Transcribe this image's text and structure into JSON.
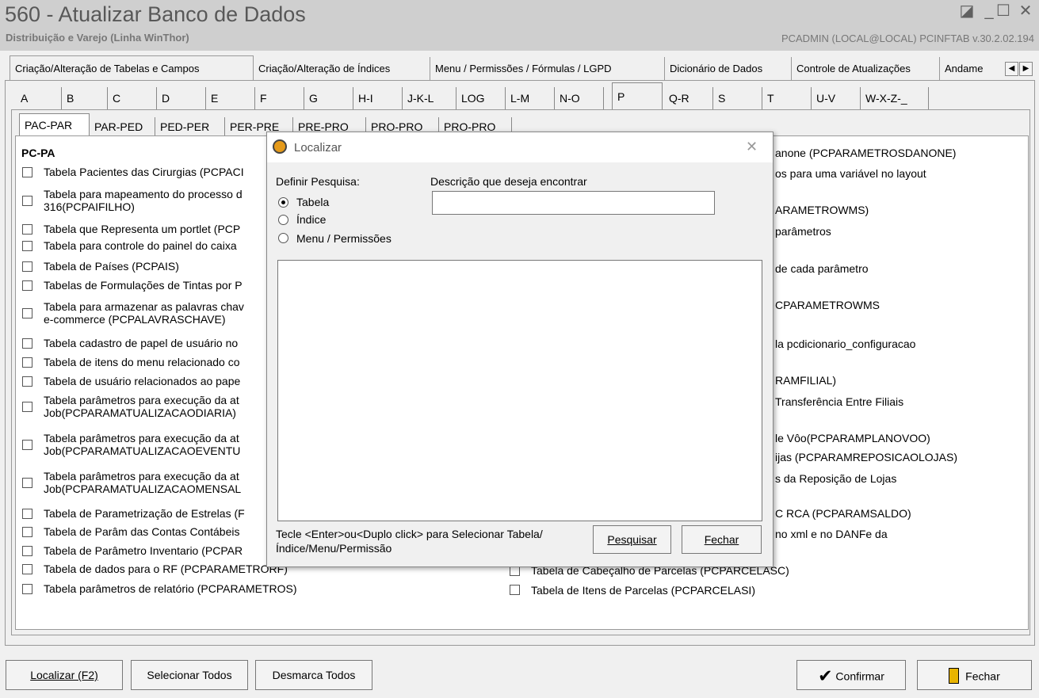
{
  "window": {
    "title": "560 - Atualizar Banco de Dados",
    "subtitle": "Distribuição e Varejo (Linha WinThor)",
    "user_info": "PCADMIN (LOCAL@LOCAL)  PCINFTAB  v.30.2.02.194",
    "controls": [
      "◪",
      "_",
      "☐",
      "✕"
    ]
  },
  "main_tabs": [
    "Criação/Alteração de Tabelas e Campos",
    "Criação/Alteração de Índices",
    "Menu / Permissões / Fórmulas / LGPD",
    "Dicionário de Dados",
    "Controle de Atualizações",
    "Andame"
  ],
  "tab_scroll": [
    "◀",
    "▶"
  ],
  "letter_tabs": [
    "A",
    "B",
    "C",
    "D",
    "E",
    "F",
    "G",
    "H-I",
    "J-K-L",
    "LOG",
    "L-M",
    "N-O",
    "P",
    "Q-R",
    "S",
    "T",
    "U-V",
    "W-X-Z-_"
  ],
  "sub_tabs": [
    "PAC-PAR",
    "PAR-PED",
    "PED-PER",
    "PER-PRE",
    "PRE-PRO",
    "PRO-PRO",
    "PRO-PRO"
  ],
  "section_title": "PC-PA",
  "left_items": [
    [
      "Tabela Pacientes das Cirurgias (PCPACI"
    ],
    [
      "Tabela para mapeamento do processo d",
      "316(PCPAIFILHO)"
    ],
    [
      "Tabela que Representa um portlet (PCP"
    ],
    [
      "Tabela para controle do painel do caixa"
    ],
    [
      "Tabela de Países (PCPAIS)"
    ],
    [
      "Tabelas de Formulações de Tintas por P"
    ],
    [
      "Tabela para armazenar as palavras chav",
      "e-commerce (PCPALAVRASCHAVE)"
    ],
    [
      "Tabela cadastro de papel de usuário no"
    ],
    [
      "Tabela de itens do menu relacionado co"
    ],
    [
      "Tabela de usuário relacionados ao pape"
    ],
    [
      "Tabela parâmetros para execução da at",
      "Job(PCPARAMATUALIZACAODIARIA)"
    ],
    [
      "Tabela parâmetros para execução da at",
      "Job(PCPARAMATUALIZACAOEVENTU"
    ],
    [
      "Tabela parâmetros para execução da at",
      "Job(PCPARAMATUALIZACAOMENSAL"
    ],
    [
      "Tabela de Parametrização de Estrelas (F"
    ],
    [
      "Tabela de Parâm das Contas Contábeis"
    ],
    [
      "Tabela de Parâmetro Inventario (PCPAR"
    ],
    [
      "Tabela de dados para o RF (PCPARAMETRORF)"
    ],
    [
      "Tabela parâmetros de relatório (PCPARAMETROS)"
    ]
  ],
  "right_fragments": [
    "anone (PCPARAMETROSDANONE)",
    "os para uma variável no layout",
    "ARAMETROWMS)",
    "parâmetros",
    "de cada parâmetro",
    "CPARAMETROWMS",
    "la pcdicionario_configuracao",
    "RAMFILIAL)",
    "Transferência Entre Filiais",
    "le Vôo(PCPARAMPLANOVOO)",
    "ijas (PCPARAMREPOSICAOLOJAS)",
    "s da Reposição de Lojas",
    "C RCA (PCPARAMSALDO)",
    "no xml e no DANFe da"
  ],
  "right_items": [
    "Tabela de Cabeçalho de Parcelas (PCPARCELASC)",
    "Tabela de Itens de Parcelas (PCPARCELASI)"
  ],
  "dialog": {
    "title": "Localizar",
    "close": "✕",
    "search_by_label": "Definir Pesquisa:",
    "options": [
      "Tabela",
      "Índice",
      "Menu / Permissões"
    ],
    "selected": "Tabela",
    "description_label": "Descrição que deseja encontrar",
    "description_value": "",
    "hint": "Tecle <Enter>ou<Duplo click> para Selecionar Tabela/Índice/Menu/Permissão",
    "search_button": "Pesquisar",
    "close_button": "Fechar"
  },
  "bottom": {
    "find_button": "Localizar (F2)",
    "select_all_button": "Selecionar Todos",
    "deselect_all_button": "Desmarca Todos",
    "confirm_button": "Confirmar",
    "close_button": "Fechar"
  }
}
